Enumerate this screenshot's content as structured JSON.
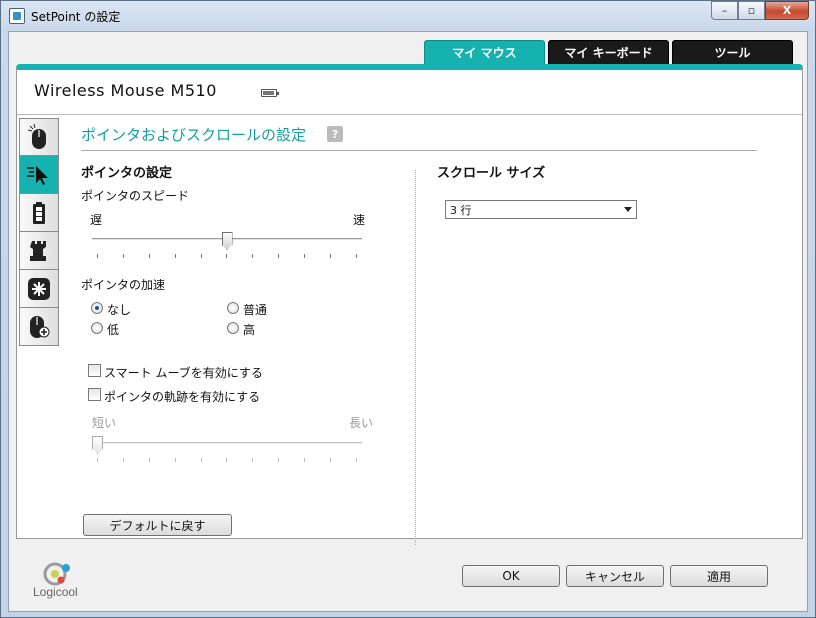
{
  "window": {
    "title": "SetPoint の設定",
    "minimize": "–",
    "maximize": "▫",
    "close": "X"
  },
  "tabs": [
    {
      "label": "マイ マウス",
      "active": true
    },
    {
      "label": "マイ キーボード",
      "active": false
    },
    {
      "label": "ツール",
      "active": false
    }
  ],
  "device": {
    "name": "Wireless Mouse M510",
    "battery_icon": "battery-icon"
  },
  "side_tabs": [
    {
      "icon": "mouse-buttons-icon",
      "active": false
    },
    {
      "icon": "pointer-icon",
      "active": true
    },
    {
      "icon": "battery-level-icon",
      "active": false
    },
    {
      "icon": "game-chess-rook-icon",
      "active": false
    },
    {
      "icon": "asterisk-icon",
      "active": false
    },
    {
      "icon": "mouse-plus-icon",
      "active": false
    }
  ],
  "section": {
    "title": "ポインタおよびスクロールの設定",
    "help": "?"
  },
  "pointer": {
    "heading": "ポインタの設定",
    "speed": {
      "label": "ポインタのスピード",
      "slow": "遅",
      "fast": "速",
      "value_fraction": 0.5
    },
    "accel": {
      "label": "ポインタの加速",
      "options": [
        {
          "label": "なし",
          "checked": true
        },
        {
          "label": "普通",
          "checked": false
        },
        {
          "label": "低",
          "checked": false
        },
        {
          "label": "高",
          "checked": false
        }
      ]
    },
    "smart_move": {
      "label": "スマート ムーブを有効にする",
      "checked": false
    },
    "trails": {
      "label": "ポインタの軌跡を有効にする",
      "checked": false,
      "short": "短い",
      "long": "長い",
      "value_fraction": 0.0
    }
  },
  "scroll": {
    "heading": "スクロール サイズ",
    "value": "3 行"
  },
  "buttons": {
    "default": "デフォルトに戻す",
    "ok": "OK",
    "cancel": "キャンセル",
    "apply": "適用"
  },
  "brand": {
    "name": "Logicool"
  },
  "colors": {
    "accent": "#15b2b0",
    "tab_inactive": "#1a1a1a"
  }
}
